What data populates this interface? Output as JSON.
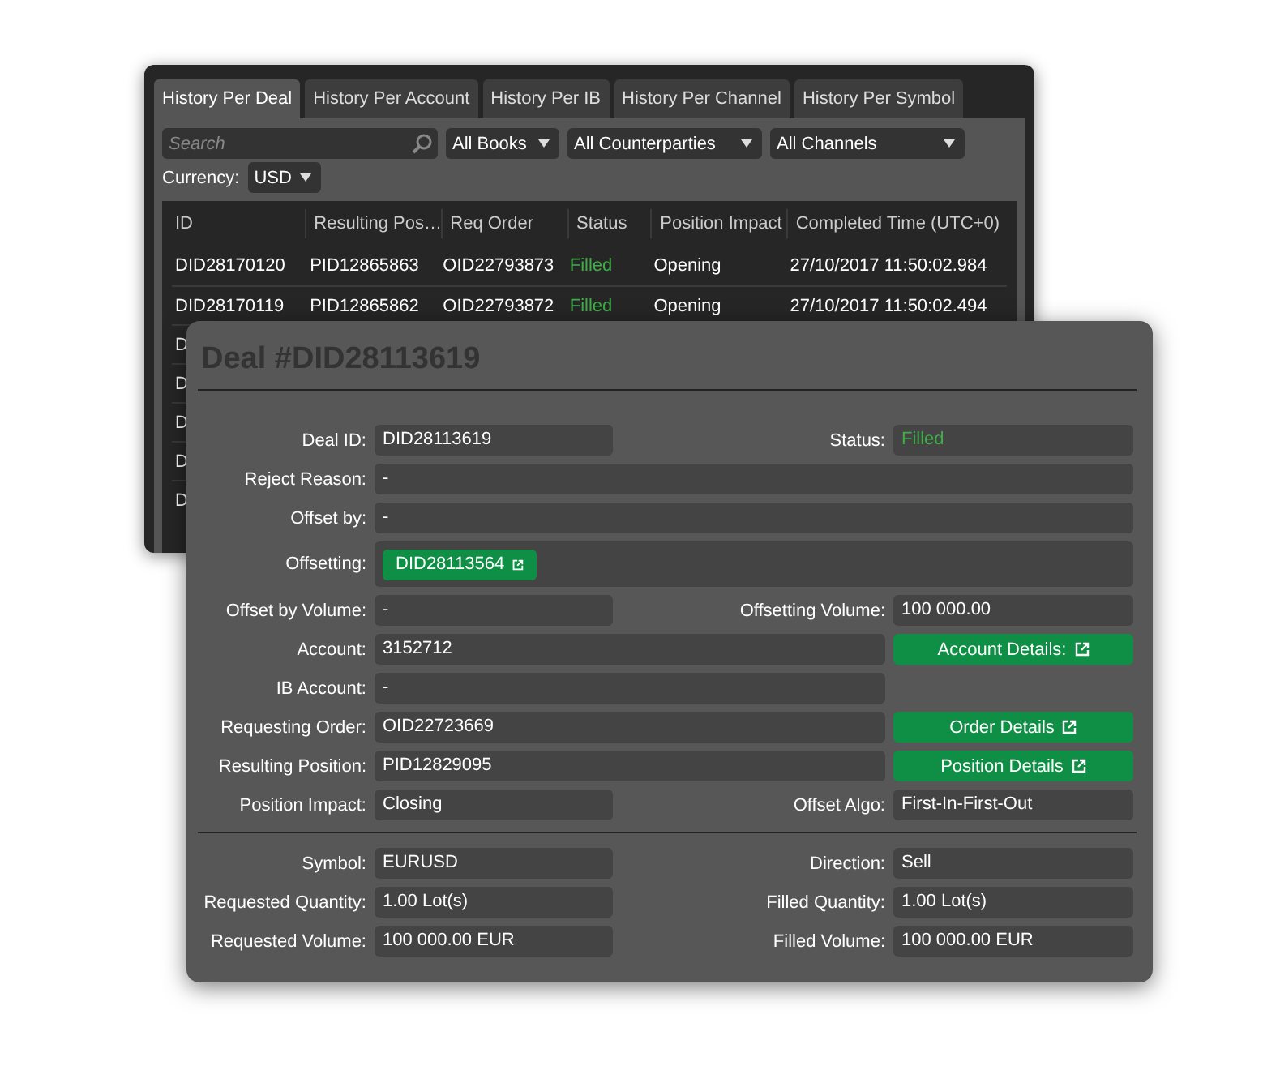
{
  "history_window": {
    "tabs": [
      {
        "label": "History Per Deal",
        "selected": true
      },
      {
        "label": "History Per Account",
        "selected": false
      },
      {
        "label": "History Per IB",
        "selected": false
      },
      {
        "label": "History Per Channel",
        "selected": false
      },
      {
        "label": "History Per Symbol",
        "selected": false
      }
    ],
    "search": {
      "placeholder": "Search"
    },
    "filters": [
      "All Books",
      "All Counterparties",
      "All Channels"
    ],
    "currency": {
      "label": "Currency:",
      "value": "USD"
    },
    "table": {
      "columns": [
        "ID",
        "Resulting Pos…",
        "Req Order",
        "Status",
        "Position Impact",
        "Completed Time (UTC+0)"
      ],
      "rows": [
        {
          "cells": [
            "DID28170120",
            "PID12865863",
            "OID22793873",
            "Filled",
            "Opening",
            "27/10/2017 11:50:02.984"
          ],
          "color": "#3fae49"
        },
        {
          "cells": [
            "DID28170119",
            "PID12865862",
            "OID22793872",
            "Filled",
            "Opening",
            "27/10/2017 11:50:02.494"
          ],
          "color": "#3fae49"
        },
        {
          "cells": [
            "D"
          ]
        },
        {
          "cells": [
            "D"
          ]
        },
        {
          "cells": [
            "D"
          ]
        },
        {
          "cells": [
            "D"
          ]
        },
        {
          "cells": [
            "D"
          ]
        }
      ]
    }
  },
  "deal_dialog": {
    "title": "Deal #DID28113619",
    "sections": [
      {
        "rows": [
          {
            "kind": "pair",
            "label": "Deal ID:",
            "value": "DID28113619",
            "right_label": "Status:",
            "right_value": "Filled",
            "color": "#3fae49"
          },
          {
            "kind": "full",
            "label": "Reject Reason:",
            "value": "-"
          },
          {
            "kind": "full",
            "label": "Offset by:",
            "value": "-"
          },
          {
            "kind": "link",
            "label": "Offsetting:",
            "value": "DID28113564"
          },
          {
            "kind": "pair",
            "label": "Offset by Volume:",
            "value": "-",
            "right_label": "Offsetting Volume:",
            "right_value": "100 000.00"
          },
          {
            "kind": "wide",
            "label": "Account:",
            "value": "3152712",
            "button": "Account Details:"
          },
          {
            "kind": "wide",
            "label": "IB Account:",
            "value": "-"
          },
          {
            "kind": "wide",
            "label": "Requesting Order:",
            "value": "OID22723669",
            "button": "Order Details"
          },
          {
            "kind": "wide",
            "label": "Resulting Position:",
            "value": "PID12829095",
            "button": "Position Details"
          },
          {
            "kind": "pair",
            "label": "Position Impact:",
            "value": "Closing",
            "right_label": "Offset Algo:",
            "right_value": "First-In-First-Out"
          }
        ]
      },
      {
        "rows": [
          {
            "kind": "pair",
            "label": "Symbol:",
            "value": "EURUSD",
            "right_label": "Direction:",
            "right_value": "Sell"
          },
          {
            "kind": "pair",
            "label": "Requested Quantity:",
            "value": "1.00 Lot(s)",
            "right_label": "Filled Quantity:",
            "right_value": "1.00 Lot(s)"
          },
          {
            "kind": "pair",
            "label": "Requested Volume:",
            "value": "100 000.00 EUR",
            "right_label": "Filled Volume:",
            "right_value": "100 000.00 EUR"
          }
        ]
      }
    ]
  }
}
